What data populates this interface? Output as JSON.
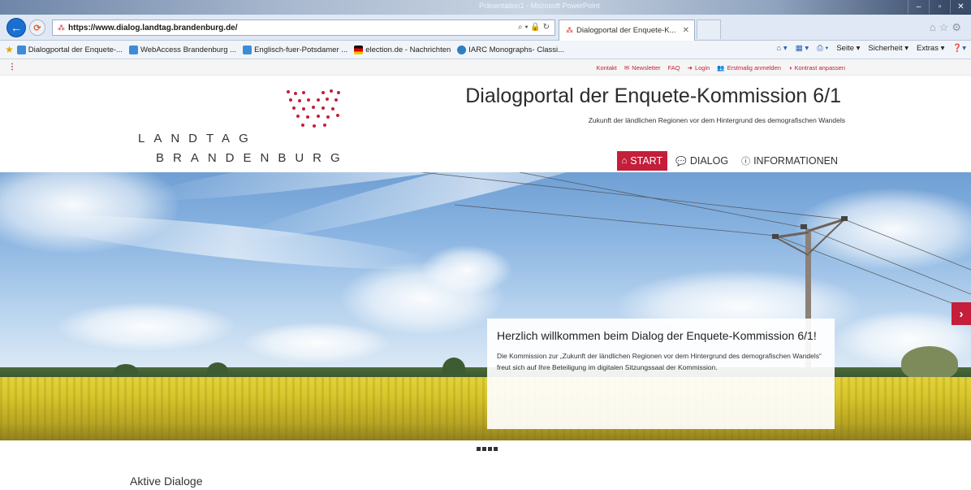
{
  "browser": {
    "window_title": "Präsentation1 - Microsoft PowerPoint",
    "url": "https://www.dialog.landtag.brandenburg.de/",
    "tab_title": "Dialogportal der Enquete-K...",
    "favorites": [
      "Dialogportal der Enquete-...",
      "WebAccess Brandenburg ...",
      "Englisch-fuer-Potsdamer ...",
      "election.de - Nachrichten",
      "IARC Monographs- Classi..."
    ],
    "menu": {
      "seite": "Seite ▾",
      "sicherheit": "Sicherheit ▾",
      "extras": "Extras ▾"
    }
  },
  "utility": {
    "links": [
      "Kontakt",
      "Newsletter",
      "FAQ",
      "Login",
      "Erstmalig anmelden",
      "Kontrast anpassen"
    ]
  },
  "header": {
    "logo_line1": "LANDTAG",
    "logo_line2": "BRANDENBURG",
    "title": "Dialogportal der Enquete-Kommission 6/1",
    "subtitle": "Zukunft der ländlichen Regionen vor dem Hintergrund des demografischen Wandels"
  },
  "nav": {
    "items": [
      "START",
      "DIALOG",
      "INFORMATIONEN"
    ],
    "active": "START"
  },
  "hero": {
    "heading": "Herzlich willkommen beim Dialog der Enquete-Kommission 6/1!",
    "text": "Die Kommission zur „Zukunft der ländlichen Regionen vor dem Hintergrund des demografischen Wandels“ freut sich auf Ihre Beteiligung im digitalen Sitzungssaal der Kommission.",
    "slide_count": 4
  },
  "section": {
    "aktive_dialoge": "Aktive Dialoge"
  },
  "colors": {
    "brand_red": "#c41e3a",
    "text_dark": "#333333"
  }
}
